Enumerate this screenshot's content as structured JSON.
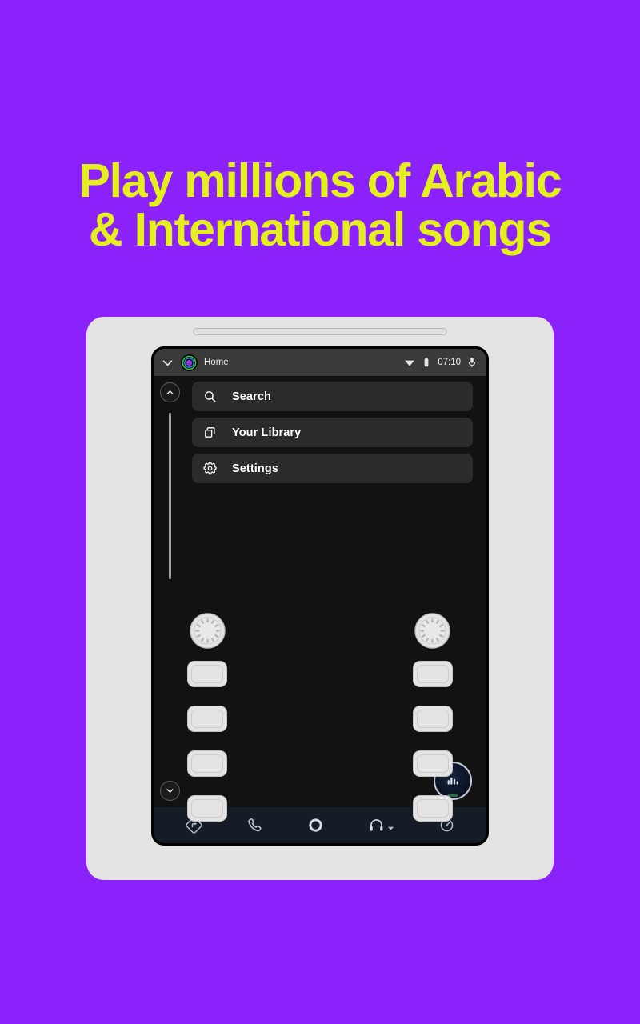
{
  "theme": {
    "background": "#8b22fc",
    "headline_color": "#e6ef1e",
    "device_body": "#e4e4e4",
    "screen_bg": "#121212",
    "statusbar_bg": "#3a3a3a",
    "menu_row_bg": "#2b2b2b",
    "bottomnav_bg": "#151c26",
    "text_primary": "#ffffff"
  },
  "headline": {
    "line1": "Play millions of Arabic",
    "line2": "& International songs"
  },
  "device": {
    "speaker_grille": "speaker-grille"
  },
  "statusbar": {
    "chevron_icon": "chevron-down-icon",
    "app_logo_icon": "app-logo-icon",
    "title": "Home",
    "wifi_icon": "wifi-icon",
    "battery_icon": "battery-icon",
    "time": "07:10",
    "mic_icon": "microphone-icon"
  },
  "rail": {
    "scroll_up_icon": "chevron-up-icon",
    "scroll_down_icon": "chevron-down-icon",
    "scrollbar": "scrollbar-thumb"
  },
  "menu": {
    "items": [
      {
        "label": "Search",
        "icon": "search-icon"
      },
      {
        "label": "Your Library",
        "icon": "library-icon"
      },
      {
        "label": "Settings",
        "icon": "gear-icon"
      }
    ]
  },
  "fab": {
    "icon": "equalizer-icon",
    "label": "Now Playing"
  },
  "bottomnav": {
    "items": [
      {
        "icon": "navigation-icon",
        "label": "Navigation"
      },
      {
        "icon": "phone-icon",
        "label": "Phone"
      },
      {
        "icon": "home-circle-icon",
        "label": "Home"
      },
      {
        "icon": "headphones-icon",
        "label": "Media",
        "has_dropdown": true
      },
      {
        "icon": "gauge-icon",
        "label": "Vehicle"
      }
    ]
  },
  "controls": {
    "left_knob": "rotary-knob-left",
    "right_knob": "rotary-knob-right",
    "left_buttons": [
      "button-l1",
      "button-l2",
      "button-l3",
      "button-l4"
    ],
    "right_buttons": [
      "button-r1",
      "button-r2",
      "button-r3",
      "button-r4"
    ]
  }
}
